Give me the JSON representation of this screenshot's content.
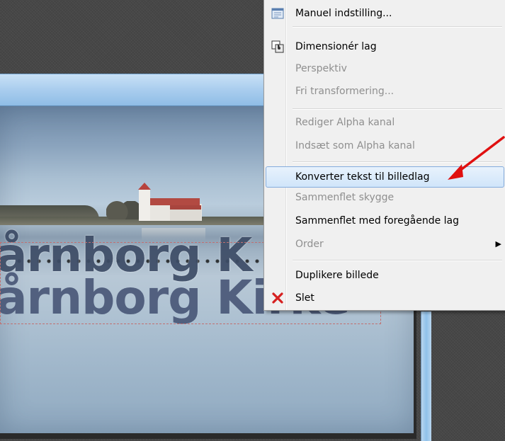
{
  "menu": {
    "items": [
      {
        "label": "Manuel indstilling...",
        "icon": "manual-settings-icon",
        "enabled": true
      },
      {
        "label": "Dimensionér lag",
        "icon": "resize-layer-icon",
        "enabled": true
      },
      {
        "label": "Perspektiv",
        "enabled": false
      },
      {
        "label": "Fri transformering...",
        "enabled": false
      },
      {
        "label": "Rediger Alpha kanal",
        "enabled": false
      },
      {
        "label": "Indsæt som Alpha kanal",
        "enabled": false
      },
      {
        "label": "Konverter tekst til billedlag",
        "enabled": true,
        "highlighted": true
      },
      {
        "label": "Sammenflet skygge",
        "enabled": false
      },
      {
        "label": "Sammenflet med foregående lag",
        "enabled": true
      },
      {
        "label": "Order",
        "enabled": false,
        "submenu": true
      },
      {
        "label": "Duplikere billede",
        "enabled": true
      },
      {
        "label": "Slet",
        "icon": "delete-x-icon",
        "enabled": true
      }
    ]
  },
  "canvas": {
    "text_layer_line1": "årnborg K",
    "text_layer_line2": "årnborg Kirke"
  },
  "colors": {
    "highlight": "#d0e5fa",
    "arrow": "#e01010",
    "delete_icon": "#d62020"
  }
}
